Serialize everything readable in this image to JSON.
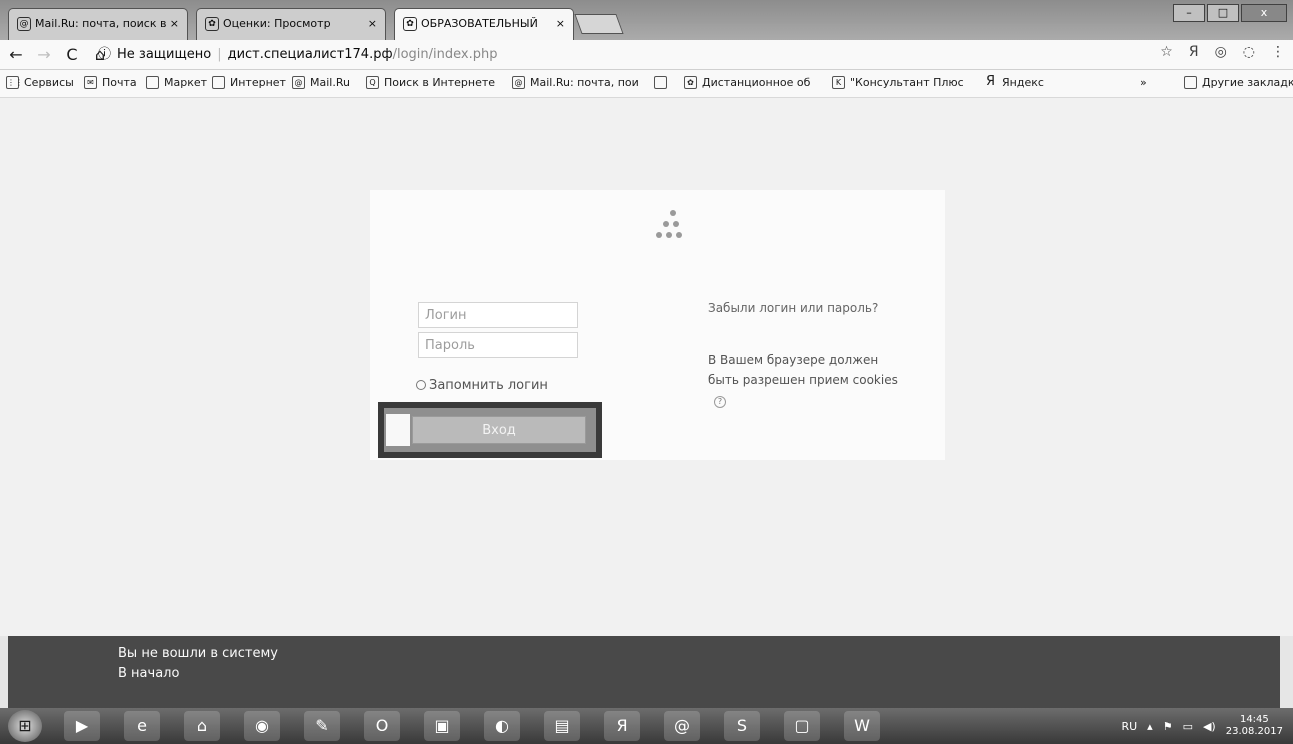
{
  "tabs": [
    {
      "icon": "mail-icon",
      "label": "Mail.Ru: почта, поиск в"
    },
    {
      "icon": "sprout-icon",
      "label": "Оценки: Просмотр"
    },
    {
      "icon": "sprout-icon",
      "label": "ОБРАЗОВАТЕЛЬНЫЙ"
    }
  ],
  "window": {
    "minimize": "–",
    "maximize": "□",
    "close": "x"
  },
  "toolbar": {
    "back": "←",
    "forward": "→",
    "reload": "C",
    "home": "⌂",
    "security": "Не защищено",
    "domain": "дист.специалист174.рф",
    "path": "/login/index.php",
    "star": "☆",
    "menu": "⋮"
  },
  "bookmarks": [
    {
      "icon": "apps-icon",
      "label": "Сервисы"
    },
    {
      "icon": "mail-folder-icon",
      "label": "Почта"
    },
    {
      "icon": "page-icon",
      "label": "Маркет"
    },
    {
      "icon": "page-icon",
      "label": "Интернет"
    },
    {
      "icon": "mailru-icon",
      "label": "Mail.Ru"
    },
    {
      "icon": "search-icon",
      "label": "Поиск в Интернете"
    },
    {
      "icon": "mailru-icon",
      "label": "Mail.Ru: почта, пои"
    },
    {
      "icon": "page-icon",
      "label": ""
    },
    {
      "icon": "sprout-icon",
      "label": "Дистанционное об"
    },
    {
      "icon": "consultant-icon",
      "label": "\"Консультант Плюс"
    },
    {
      "icon": "yandex-icon",
      "label": "Яндекс"
    }
  ],
  "bookmarks_more": "»",
  "bookmarks_other": "Другие закладки",
  "login": {
    "username_placeholder": "Логин",
    "password_placeholder": "Пароль",
    "remember_label": "Запомнить логин",
    "submit_label": "Вход",
    "forgot_text": "Забыли логин или пароль?",
    "cookies_text": "В Вашем браузере должен быть разрешен прием cookies"
  },
  "footer": {
    "status": "Вы не вошли в систему",
    "home_link": "В начало"
  },
  "taskbar": {
    "lang": "RU",
    "time": "14:45",
    "date": "23.08.2017",
    "apps": [
      "media-player-icon",
      "ie-icon",
      "home-app-icon",
      "chrome-icon",
      "paint-icon",
      "opera-icon",
      "explorer-icon",
      "player-icon",
      "archive-icon",
      "yandex-browser-icon",
      "mail-agent-icon",
      "skype-icon",
      "terminal-icon",
      "word-icon"
    ]
  }
}
